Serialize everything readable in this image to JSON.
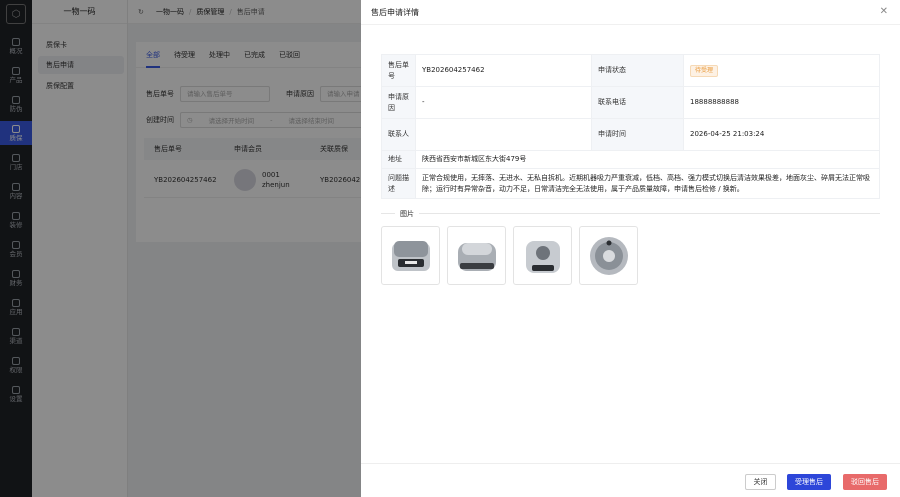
{
  "rail": {
    "items": [
      {
        "label": "概况",
        "icon": "overview-icon"
      },
      {
        "label": "产品",
        "icon": "product-icon"
      },
      {
        "label": "防伪",
        "icon": "anti-fake-icon"
      },
      {
        "label": "质保",
        "icon": "warranty-icon"
      },
      {
        "label": "门店",
        "icon": "store-icon"
      },
      {
        "label": "内容",
        "icon": "content-icon"
      },
      {
        "label": "装修",
        "icon": "decorate-icon"
      },
      {
        "label": "会员",
        "icon": "member-icon"
      },
      {
        "label": "财务",
        "icon": "finance-icon"
      },
      {
        "label": "应用",
        "icon": "apps-icon"
      },
      {
        "label": "渠道",
        "icon": "channel-icon"
      },
      {
        "label": "权限",
        "icon": "permission-icon"
      },
      {
        "label": "设置",
        "icon": "settings-icon"
      }
    ],
    "active_index": 3
  },
  "submenu": {
    "title": "一物一码",
    "items": [
      "质保卡",
      "售后申请",
      "质保配置"
    ],
    "active_index": 1
  },
  "breadcrumb": [
    "一物一码",
    "质保管理",
    "售后申请"
  ],
  "tabs": [
    "全部",
    "待受理",
    "处理中",
    "已完成",
    "已驳回"
  ],
  "filters": {
    "aftersale_no_label": "售后单号",
    "aftersale_no_placeholder": "请输入售后单号",
    "reason_label": "申请原因",
    "reason_placeholder": "请输入申请",
    "created_label": "创建时间",
    "start_placeholder": "请选择开始时间",
    "range_sep": "-",
    "end_placeholder": "请选择结束时间"
  },
  "table": {
    "headers": [
      "售后单号",
      "申请会员",
      "关联质保"
    ],
    "rows": [
      {
        "no": "YB202604257462",
        "member_id": "0001",
        "member_name": "zhenjun",
        "warranty": "YB2026042"
      }
    ]
  },
  "drawer": {
    "title": "售后申请详情",
    "fields": {
      "no_label": "售后单号",
      "no_value": "YB202604257462",
      "status_label": "申请状态",
      "status_value": "待受理",
      "reason_label": "申请原因",
      "reason_value": "-",
      "phone_label": "联系电话",
      "phone_value": "18888888888",
      "contact_label": "联系人",
      "contact_value": "",
      "time_label": "申请时间",
      "time_value": "2026-04-25 21:03:24",
      "address_label": "地址",
      "address_value": "陕西省西安市新城区东大街479号",
      "desc_label": "问题描述",
      "desc_value": "正常合规使用，无摔落、无进水、无私自拆机。近期机器吸力严重衰减，低档、高档、强力模式切换后清洁效果极差，地面灰尘、碎屑无法正常吸除；运行时有异常杂音，动力不足，日常清洁完全无法使用，属于产品质量故障，申请售后检修 / 换新。"
    },
    "images_title": "图片",
    "images": [
      "robot-vacuum-front",
      "robot-vacuum-side",
      "robot-vacuum-back",
      "robot-vacuum-top"
    ],
    "buttons": {
      "close": "关闭",
      "accept": "受理售后",
      "reject": "驳回售后"
    },
    "colors": {
      "primary": "#2d46d9",
      "danger": "#e86a6a",
      "pending": "#e89a3c"
    }
  }
}
